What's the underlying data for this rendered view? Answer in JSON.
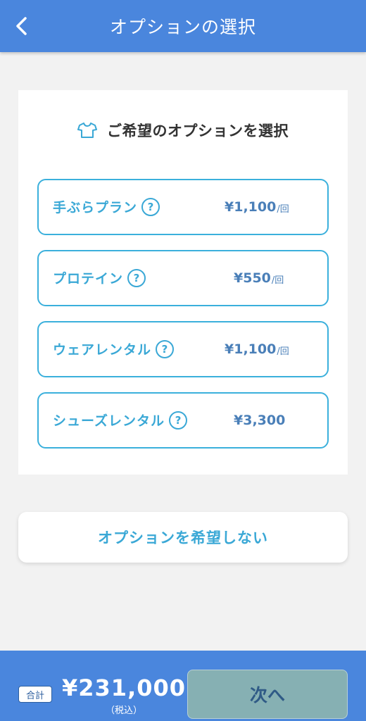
{
  "header": {
    "title": "オプションの選択",
    "back_icon": "chevron-left-icon"
  },
  "card": {
    "heading": "ご希望のオプションを選択",
    "heading_icon": "tshirt-icon",
    "options": [
      {
        "name": "手ぶらプラン",
        "price": "¥1,100",
        "unit": "/回",
        "help": "?"
      },
      {
        "name": "プロテイン",
        "price": "¥550",
        "unit": "/回",
        "help": "?"
      },
      {
        "name": "ウェアレンタル",
        "price": "¥1,100",
        "unit": "/回",
        "help": "?"
      },
      {
        "name": "シューズレンタル",
        "price": "¥3,300",
        "unit": "",
        "help": "?"
      }
    ]
  },
  "no_option_label": "オプションを希望しない",
  "footer": {
    "total_label": "合計",
    "total_amount": "¥231,000",
    "tax_note": "（税込）",
    "next_label": "次へ"
  },
  "colors": {
    "header_bg": "#4a86dd",
    "accent": "#3aa8d6",
    "price": "#4a7fb8",
    "next_button_bg": "#86b0b3"
  }
}
